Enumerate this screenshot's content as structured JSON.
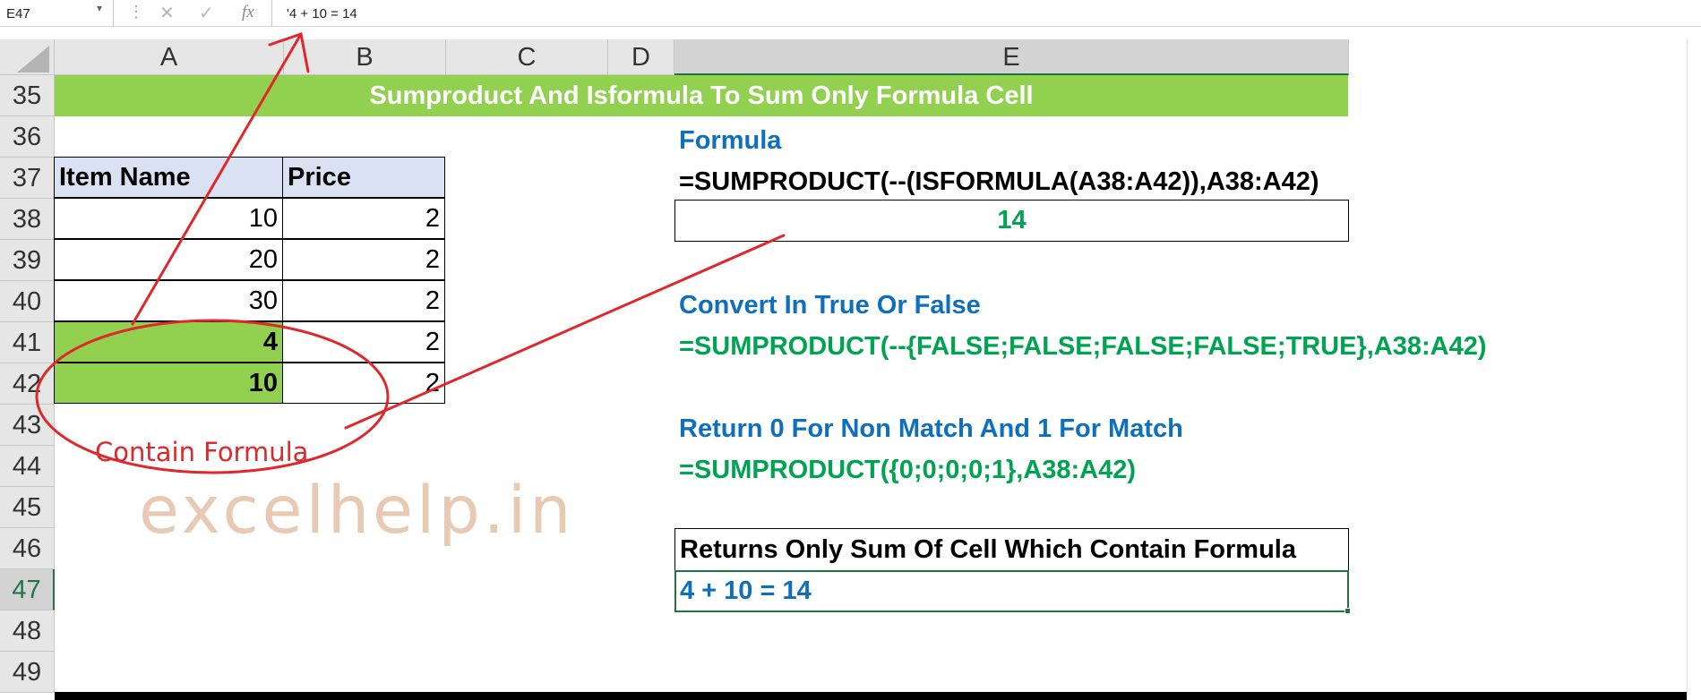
{
  "formula_bar": {
    "name_box": "E47",
    "fx": "fx",
    "content": "'4 + 10 = 14"
  },
  "columns": [
    "A",
    "B",
    "C",
    "D",
    "E"
  ],
  "rows": [
    "35",
    "36",
    "37",
    "38",
    "39",
    "40",
    "41",
    "42",
    "43",
    "44",
    "45",
    "46",
    "47",
    "48",
    "49"
  ],
  "banner": "Sumproduct And Isformula To Sum Only Formula Cell",
  "table": {
    "headers": [
      "Item Name",
      "Price"
    ],
    "rows": [
      [
        "10",
        "2"
      ],
      [
        "20",
        "2"
      ],
      [
        "30",
        "2"
      ],
      [
        "4",
        "2"
      ],
      [
        "10",
        "2"
      ]
    ]
  },
  "right": {
    "formula_label": "Formula",
    "formula": "=SUMPRODUCT(--(ISFORMULA(A38:A42)),A38:A42)",
    "result": "14",
    "convert_label": "Convert In True Or False",
    "convert_formula": "=SUMPRODUCT(--{FALSE;FALSE;FALSE;FALSE;TRUE},A38:A42)",
    "return_label": "Return 0 For Non Match And 1 For Match",
    "return_formula": "=SUMPRODUCT({0;0;0;0;1},A38:A42)",
    "returns_label": "Returns Only Sum Of Cell Which Contain Formula",
    "returns_value": "4 + 10 = 14"
  },
  "annotation": "Contain Formula",
  "watermark": "excelhelp.in",
  "colors": {
    "banner": "#92d050",
    "header_fill": "#d9e1f2",
    "blue_text": "#0d6fbe",
    "green_text": "#00a34f",
    "annotation": "#e0272b",
    "selection": "#217346"
  }
}
